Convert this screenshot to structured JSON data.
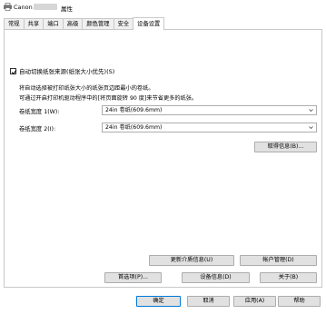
{
  "window": {
    "title_prefix": "Canon",
    "title_suffix": "属性"
  },
  "tabs": [
    "常规",
    "共享",
    "端口",
    "高级",
    "颜色管理",
    "安全",
    "设备设置"
  ],
  "active_tab": "设备设置",
  "auto_switch": {
    "label": "自动切换纸张来源(纸张大小优先)(S)",
    "checked": true
  },
  "descriptions": [
    "将自动选择被打印纸张大小的纸张页边距最小的卷纸。",
    "可通过开启打印机驱动程序中的[将页面旋转 90 度]来节省更多的纸张。"
  ],
  "rolls": [
    {
      "label": "卷纸宽度 1(W):",
      "value": "24in 卷纸(609.6mm)"
    },
    {
      "label": "卷纸宽度 2(I):",
      "value": "24in 卷纸(609.6mm)"
    }
  ],
  "buttons": {
    "get_info": "取得信息(B)...",
    "update_media": "更新介质信息(U)",
    "account": "帐户管理(D)",
    "preferences": "首选项(P)...",
    "device_info": "设备信息(D)",
    "about": "关于(B)",
    "ok": "确定",
    "cancel": "取消",
    "apply": "应用(A)",
    "help": "帮助"
  }
}
